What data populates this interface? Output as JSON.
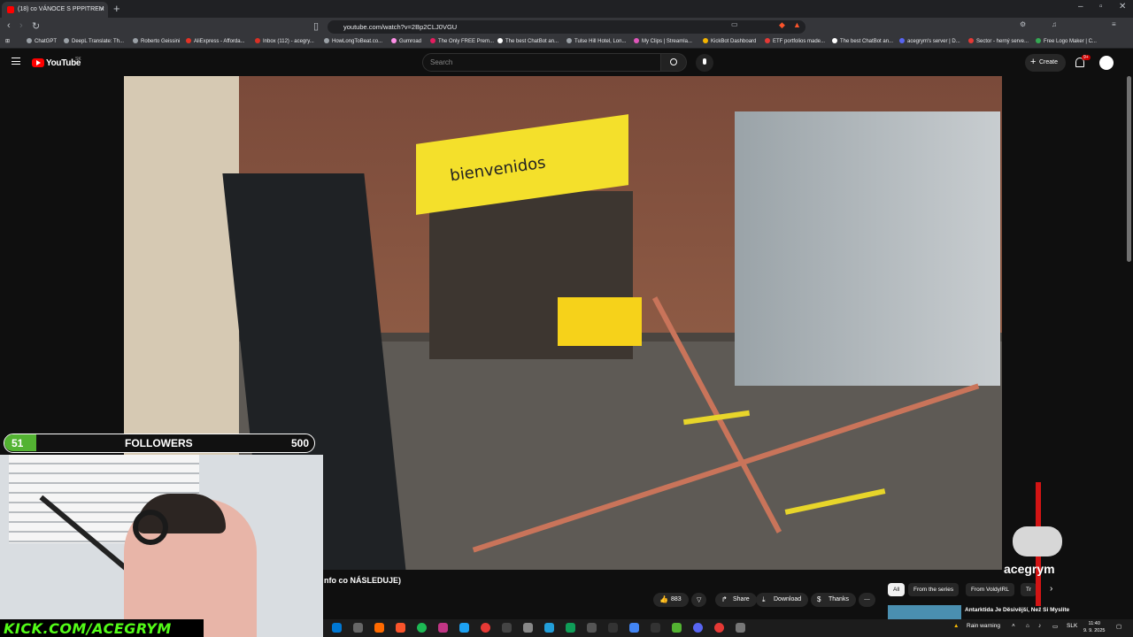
{
  "browser": {
    "tab_title": "(18) co VÁNOCE S PPPITREM",
    "url": "youtube.com/watch?v=2Bp2CLJ0VGU",
    "bookmarks": [
      "ChatGPT",
      "DeepL Translate: Th...",
      "Roberto Geissini",
      "AliExpress - Afforda...",
      "Inbox (112) - acegry...",
      "HowLongToBeat.co...",
      "Gumroad",
      "The Only FREE Prem...",
      "The best ChatBot an...",
      "Tulse Hill Hotel, Lon...",
      "My Clips | Streamla...",
      "KickBot Dashboard",
      "ETF portfolios made...",
      "The best ChatBot an...",
      "acegrym's server | D...",
      "Sector - herný serve...",
      "Free Logo Maker | C..."
    ]
  },
  "youtube": {
    "logo_text": "YouTube",
    "region": "SK",
    "search_placeholder": "Search",
    "create_label": "Create",
    "notif_count": "9+",
    "video_title": "nfo co NÁSLEDUJE)",
    "video_sign": "bienvenidos",
    "actions": {
      "likes": "883",
      "share": "Share",
      "download": "Download",
      "thanks": "Thanks"
    },
    "chips": [
      "All",
      "From the series",
      "From VoldyIRL",
      "Tr"
    ],
    "rec_title": "Antarktida Je Děsivější, Než Si Myslíte"
  },
  "overlay": {
    "followers_current": "51",
    "followers_label": "FOLLOWERS",
    "followers_goal": "500",
    "followers_fraction": 0.102,
    "kick_text": "KICK.COM/ACEGRYM",
    "logo_text": "acegrym"
  },
  "taskbar": {
    "weather": "Rain warning",
    "lang": "SLK",
    "time": "11:40",
    "date": "9. 9. 2025"
  }
}
